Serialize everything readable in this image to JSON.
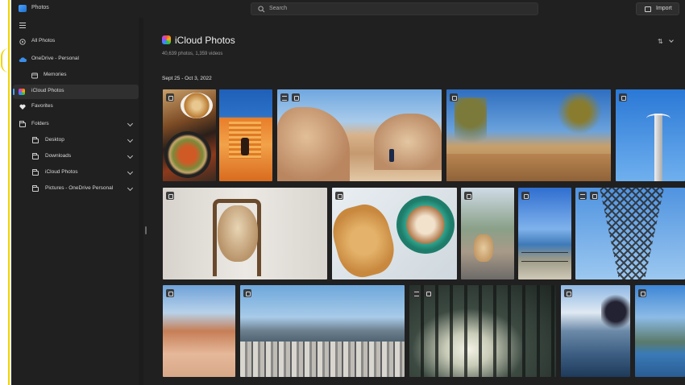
{
  "app": {
    "title": "Photos"
  },
  "search": {
    "placeholder": "Search"
  },
  "toolbar": {
    "import_label": "Import"
  },
  "sidebar": {
    "items": [
      {
        "label": "All Photos",
        "icon": "all-photos-icon"
      },
      {
        "label": "OneDrive - Personal",
        "icon": "cloud-icon"
      },
      {
        "label": "Memories",
        "icon": "memories-icon"
      },
      {
        "label": "iCloud Photos",
        "icon": "icloud-photos-icon",
        "active": true
      },
      {
        "label": "Favorites",
        "icon": "heart-icon"
      },
      {
        "label": "Folders",
        "icon": "folder-icon"
      },
      {
        "label": "Desktop",
        "icon": "folder-icon"
      },
      {
        "label": "Downloads",
        "icon": "folder-icon"
      },
      {
        "label": "iCloud Photos",
        "icon": "folder-icon"
      },
      {
        "label": "Pictures - OneDrive Personal",
        "icon": "folder-icon"
      }
    ]
  },
  "main": {
    "title": "iCloud Photos",
    "subtitle": "40,639 photos, 1,359 videos",
    "date_group": "Sept 25 - Oct 3, 2022"
  },
  "colors": {
    "accent": "#4aa3ff",
    "background": "#202020",
    "sidebar_active": "#2f2f2f"
  }
}
